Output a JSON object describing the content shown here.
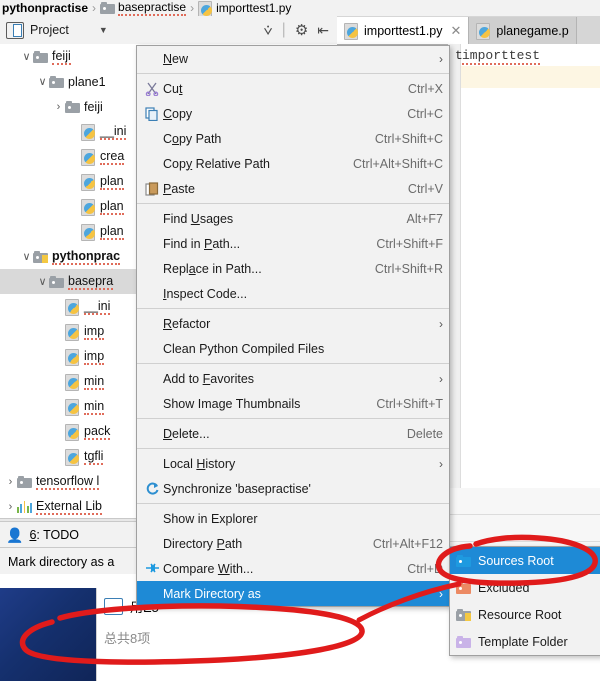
{
  "breadcrumb": {
    "items": [
      {
        "label": "pythonpractise",
        "icon": "folder-icon",
        "bold": true
      },
      {
        "label": "basepractise",
        "icon": "folder-icon",
        "bold": false
      },
      {
        "label": "importtest1.py",
        "icon": "python-file-icon",
        "bold": false
      }
    ],
    "separator": "›"
  },
  "project_panel": {
    "title": "Project",
    "dropdown_caret": "▼",
    "tools": [
      {
        "name": "collapse-all-icon",
        "glyph": "⩒"
      },
      {
        "name": "settings-gear-icon",
        "glyph": "⚙"
      },
      {
        "name": "hide-panel-icon",
        "glyph": "⇤"
      }
    ]
  },
  "editor_tabs": [
    {
      "label": "importtest1.py",
      "active": true,
      "closeable": true,
      "close_glyph": "✕"
    },
    {
      "label": "planegame.p",
      "active": false,
      "closeable": false,
      "close_glyph": ""
    }
  ],
  "editor": {
    "gutter_text": "t",
    "code_text": "importtest"
  },
  "tree": {
    "rows": [
      {
        "label": "feiji",
        "indent": 1,
        "arrow": "∨",
        "icon": "folder-icon",
        "selected": false,
        "bold": false,
        "clipped": true
      },
      {
        "label": "plane1",
        "indent": 2,
        "arrow": "∨",
        "icon": "folder-icon",
        "selected": false,
        "bold": false,
        "clipped": false
      },
      {
        "label": "feiji",
        "indent": 3,
        "arrow": "›",
        "icon": "folder-icon",
        "selected": false,
        "bold": false,
        "clipped": false
      },
      {
        "label": "__ini",
        "indent": 4,
        "arrow": "",
        "icon": "python-file-icon",
        "selected": false,
        "bold": false,
        "clipped": true
      },
      {
        "label": "crea",
        "indent": 4,
        "arrow": "",
        "icon": "python-file-icon",
        "selected": false,
        "bold": false,
        "clipped": true
      },
      {
        "label": "plan",
        "indent": 4,
        "arrow": "",
        "icon": "python-file-icon",
        "selected": false,
        "bold": false,
        "clipped": true
      },
      {
        "label": "plan",
        "indent": 4,
        "arrow": "",
        "icon": "python-file-icon",
        "selected": false,
        "bold": false,
        "clipped": true
      },
      {
        "label": "plan",
        "indent": 4,
        "arrow": "",
        "icon": "python-file-icon",
        "selected": false,
        "bold": false,
        "clipped": true
      },
      {
        "label": "pythonprac",
        "indent": 1,
        "arrow": "∨",
        "icon": "module-folder-icon",
        "selected": false,
        "bold": true,
        "clipped": true
      },
      {
        "label": "basepra",
        "indent": 2,
        "arrow": "∨",
        "icon": "folder-icon",
        "selected": true,
        "bold": false,
        "clipped": true
      },
      {
        "label": "__ini",
        "indent": 3,
        "arrow": "",
        "icon": "python-file-icon",
        "selected": false,
        "bold": false,
        "clipped": true
      },
      {
        "label": "imp",
        "indent": 3,
        "arrow": "",
        "icon": "python-file-icon",
        "selected": false,
        "bold": false,
        "clipped": true
      },
      {
        "label": "imp",
        "indent": 3,
        "arrow": "",
        "icon": "python-file-icon",
        "selected": false,
        "bold": false,
        "clipped": true
      },
      {
        "label": "min",
        "indent": 3,
        "arrow": "",
        "icon": "python-file-icon",
        "selected": false,
        "bold": false,
        "clipped": true
      },
      {
        "label": "min",
        "indent": 3,
        "arrow": "",
        "icon": "python-file-icon",
        "selected": false,
        "bold": false,
        "clipped": true
      },
      {
        "label": "pack",
        "indent": 3,
        "arrow": "",
        "icon": "python-file-icon",
        "selected": false,
        "bold": false,
        "clipped": true
      },
      {
        "label": "tgfli",
        "indent": 3,
        "arrow": "",
        "icon": "python-file-icon",
        "selected": false,
        "bold": false,
        "clipped": true
      },
      {
        "label": "tensorflow l",
        "indent": 0,
        "arrow": "›",
        "icon": "folder-icon",
        "selected": false,
        "bold": false,
        "clipped": true
      },
      {
        "label": "External Lib",
        "indent": 0,
        "arrow": "›",
        "icon": "library-icon",
        "selected": false,
        "bold": false,
        "clipped": true
      }
    ]
  },
  "context_menu": {
    "items": [
      {
        "label": "New",
        "shortcut": "",
        "icon": "",
        "submenu": true,
        "highlighted": false,
        "mnemonic": "N",
        "sep_after": true
      },
      {
        "label": "Cut",
        "shortcut": "Ctrl+X",
        "icon": "cut-icon",
        "submenu": false,
        "highlighted": false,
        "mnemonic": "t",
        "sep_after": false
      },
      {
        "label": "Copy",
        "shortcut": "Ctrl+C",
        "icon": "copy-icon",
        "submenu": false,
        "highlighted": false,
        "mnemonic": "C",
        "sep_after": false
      },
      {
        "label": "Copy Path",
        "shortcut": "Ctrl+Shift+C",
        "icon": "",
        "submenu": false,
        "highlighted": false,
        "mnemonic": "o",
        "sep_after": false
      },
      {
        "label": "Copy Relative Path",
        "shortcut": "Ctrl+Alt+Shift+C",
        "icon": "",
        "submenu": false,
        "highlighted": false,
        "mnemonic": "y",
        "sep_after": false
      },
      {
        "label": "Paste",
        "shortcut": "Ctrl+V",
        "icon": "paste-icon",
        "submenu": false,
        "highlighted": false,
        "mnemonic": "P",
        "sep_after": true
      },
      {
        "label": "Find Usages",
        "shortcut": "Alt+F7",
        "icon": "",
        "submenu": false,
        "highlighted": false,
        "mnemonic": "U",
        "sep_after": false
      },
      {
        "label": "Find in Path...",
        "shortcut": "Ctrl+Shift+F",
        "icon": "",
        "submenu": false,
        "highlighted": false,
        "mnemonic": "P",
        "sep_after": false
      },
      {
        "label": "Replace in Path...",
        "shortcut": "Ctrl+Shift+R",
        "icon": "",
        "submenu": false,
        "highlighted": false,
        "mnemonic": "a",
        "sep_after": false
      },
      {
        "label": "Inspect Code...",
        "shortcut": "",
        "icon": "",
        "submenu": false,
        "highlighted": false,
        "mnemonic": "I",
        "sep_after": true
      },
      {
        "label": "Refactor",
        "shortcut": "",
        "icon": "",
        "submenu": true,
        "highlighted": false,
        "mnemonic": "R",
        "sep_after": false
      },
      {
        "label": "Clean Python Compiled Files",
        "shortcut": "",
        "icon": "",
        "submenu": false,
        "highlighted": false,
        "mnemonic": "",
        "sep_after": true
      },
      {
        "label": "Add to Favorites",
        "shortcut": "",
        "icon": "",
        "submenu": true,
        "highlighted": false,
        "mnemonic": "F",
        "sep_after": false
      },
      {
        "label": "Show Image Thumbnails",
        "shortcut": "Ctrl+Shift+T",
        "icon": "",
        "submenu": false,
        "highlighted": false,
        "mnemonic": "g",
        "sep_after": true
      },
      {
        "label": "Delete...",
        "shortcut": "Delete",
        "icon": "",
        "submenu": false,
        "highlighted": false,
        "mnemonic": "D",
        "sep_after": true
      },
      {
        "label": "Local History",
        "shortcut": "",
        "icon": "",
        "submenu": true,
        "highlighted": false,
        "mnemonic": "H",
        "sep_after": false
      },
      {
        "label": "Synchronize 'basepractise'",
        "shortcut": "",
        "icon": "sync-icon",
        "submenu": false,
        "highlighted": false,
        "mnemonic": "",
        "sep_after": true
      },
      {
        "label": "Show in Explorer",
        "shortcut": "",
        "icon": "",
        "submenu": false,
        "highlighted": false,
        "mnemonic": "",
        "sep_after": false
      },
      {
        "label": "Directory Path",
        "shortcut": "Ctrl+Alt+F12",
        "icon": "",
        "submenu": false,
        "highlighted": false,
        "mnemonic": "P",
        "sep_after": false
      },
      {
        "label": "Compare With...",
        "shortcut": "Ctrl+D",
        "icon": "compare-icon",
        "submenu": false,
        "highlighted": false,
        "mnemonic": "W",
        "sep_after": false
      },
      {
        "label": "Mark Directory as",
        "shortcut": "",
        "icon": "",
        "submenu": true,
        "highlighted": true,
        "mnemonic": "",
        "sep_after": false
      }
    ]
  },
  "submenu": {
    "items": [
      {
        "label": "Sources Root",
        "icon": "sources-root-folder-icon",
        "highlighted": true
      },
      {
        "label": "Excluded",
        "icon": "excluded-folder-icon",
        "highlighted": false
      },
      {
        "label": "Resource Root",
        "icon": "resource-root-folder-icon",
        "highlighted": false
      },
      {
        "label": "Template Folder",
        "icon": "template-folder-icon",
        "highlighted": false
      }
    ]
  },
  "todo_bar": {
    "label": "6: TODO",
    "mnemonic": "6"
  },
  "status_bar": {
    "message": "Mark directory as a"
  },
  "taskbar": {
    "row1_label": "用E5",
    "row2_label": "总共8项"
  },
  "colors": {
    "menu_highlight": "#1e8ad6",
    "annotation_red": "#e01b1b",
    "selection_gray": "#d9d9d9",
    "code_line_highlight": "#fdf6e3"
  }
}
